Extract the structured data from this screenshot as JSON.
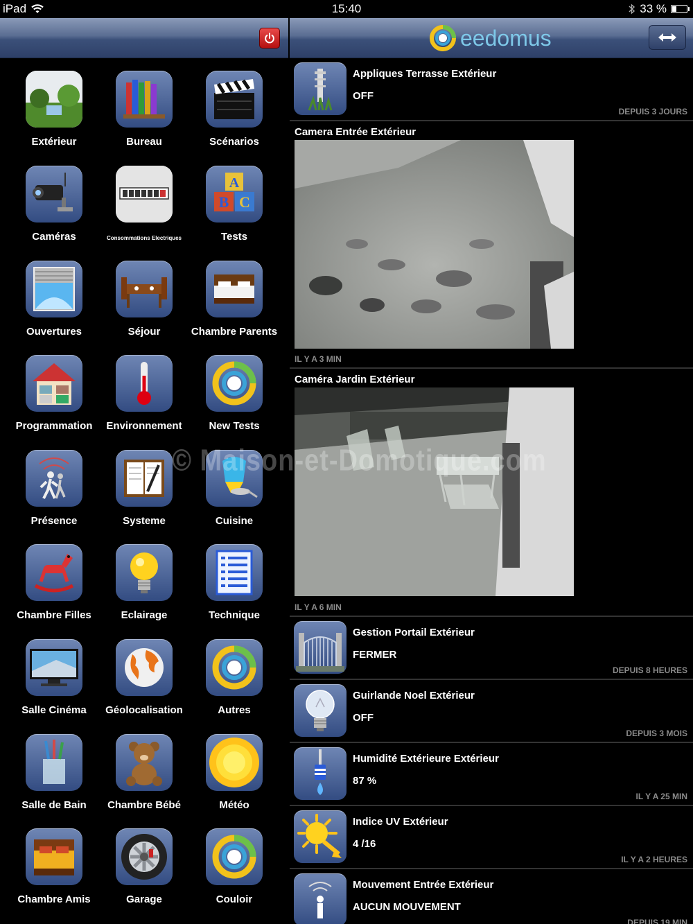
{
  "status_bar": {
    "device": "iPad",
    "time": "15:40",
    "battery": "33 %",
    "battery_level": 0.33,
    "icons": [
      "wifi-icon",
      "bluetooth-icon",
      "battery-icon"
    ]
  },
  "header": {
    "logo_text": "eedomus",
    "power_icon": "power-icon",
    "swap_icon": "swap-arrows-icon"
  },
  "colors": {
    "navbar": "#3b5079",
    "tile": "#4c6396",
    "logo": "#7ec8e8",
    "timestamp": "#8a8a8a",
    "power": "#c91a1a"
  },
  "rooms": [
    {
      "label": "Extérieur",
      "icon": "garden-icon"
    },
    {
      "label": "Bureau",
      "icon": "books-icon"
    },
    {
      "label": "Scénarios",
      "icon": "clapperboard-icon"
    },
    {
      "label": "Caméras",
      "icon": "camera-icon"
    },
    {
      "label": "Consommations Electriques",
      "icon": "meter-icon"
    },
    {
      "label": "Tests",
      "icon": "abc-blocks-icon"
    },
    {
      "label": "Ouvertures",
      "icon": "window-shutter-icon"
    },
    {
      "label": "Séjour",
      "icon": "dining-table-icon"
    },
    {
      "label": "Chambre Parents",
      "icon": "bed-icon"
    },
    {
      "label": "Programmation",
      "icon": "house-icon"
    },
    {
      "label": "Environnement",
      "icon": "thermometer-icon"
    },
    {
      "label": "New Tests",
      "icon": "eedomus-ring-icon"
    },
    {
      "label": "Présence",
      "icon": "presence-icon"
    },
    {
      "label": "Systeme",
      "icon": "notebook-icon"
    },
    {
      "label": "Cuisine",
      "icon": "kitchen-icon"
    },
    {
      "label": "Chambre Filles",
      "icon": "rocking-horse-icon"
    },
    {
      "label": "Eclairage",
      "icon": "lightbulb-icon"
    },
    {
      "label": "Technique",
      "icon": "list-icon"
    },
    {
      "label": "Salle Cinéma",
      "icon": "tv-icon"
    },
    {
      "label": "Géolocalisation",
      "icon": "globe-icon"
    },
    {
      "label": "Autres",
      "icon": "eedomus-ring-icon"
    },
    {
      "label": "Salle de Bain",
      "icon": "toothbrush-icon"
    },
    {
      "label": "Chambre Bébé",
      "icon": "teddy-bear-icon"
    },
    {
      "label": "Météo",
      "icon": "sun-icon"
    },
    {
      "label": "Chambre Amis",
      "icon": "guest-bed-icon"
    },
    {
      "label": "Garage",
      "icon": "wheel-icon"
    },
    {
      "label": "Couloir",
      "icon": "eedomus-ring-icon"
    }
  ],
  "devices": [
    {
      "name": "Appliques Terrasse Extérieur",
      "state": "OFF",
      "time": "DEPUIS 3 JOURS",
      "icon": "garden-light-icon"
    },
    {
      "name": "Gestion Portail Extérieur",
      "state": "FERMER",
      "time": "DEPUIS 8 HEURES",
      "icon": "gate-icon"
    },
    {
      "name": "Guirlande Noel Extérieur",
      "state": "OFF",
      "time": "DEPUIS 3 MOIS",
      "icon": "lightbulb-icon"
    },
    {
      "name": "Humidité Extérieure Extérieur",
      "state": "87 %",
      "time": "IL Y A 25 MIN",
      "icon": "humidity-sensor-icon"
    },
    {
      "name": "Indice UV Extérieur",
      "state": "4 /16",
      "time": "IL Y A 2 HEURES",
      "icon": "uv-sun-icon"
    },
    {
      "name": "Mouvement Entrée Extérieur",
      "state": "AUCUN MOUVEMENT",
      "time": "DEPUIS 19 MIN",
      "icon": "motion-icon"
    }
  ],
  "cameras": [
    {
      "name": "Camera Entrée Extérieur",
      "time": "IL Y A 3 MIN"
    },
    {
      "name": "Caméra Jardin Extérieur",
      "time": "IL Y A 6 MIN"
    }
  ],
  "watermark": "© Maison-et-Domotique.com"
}
